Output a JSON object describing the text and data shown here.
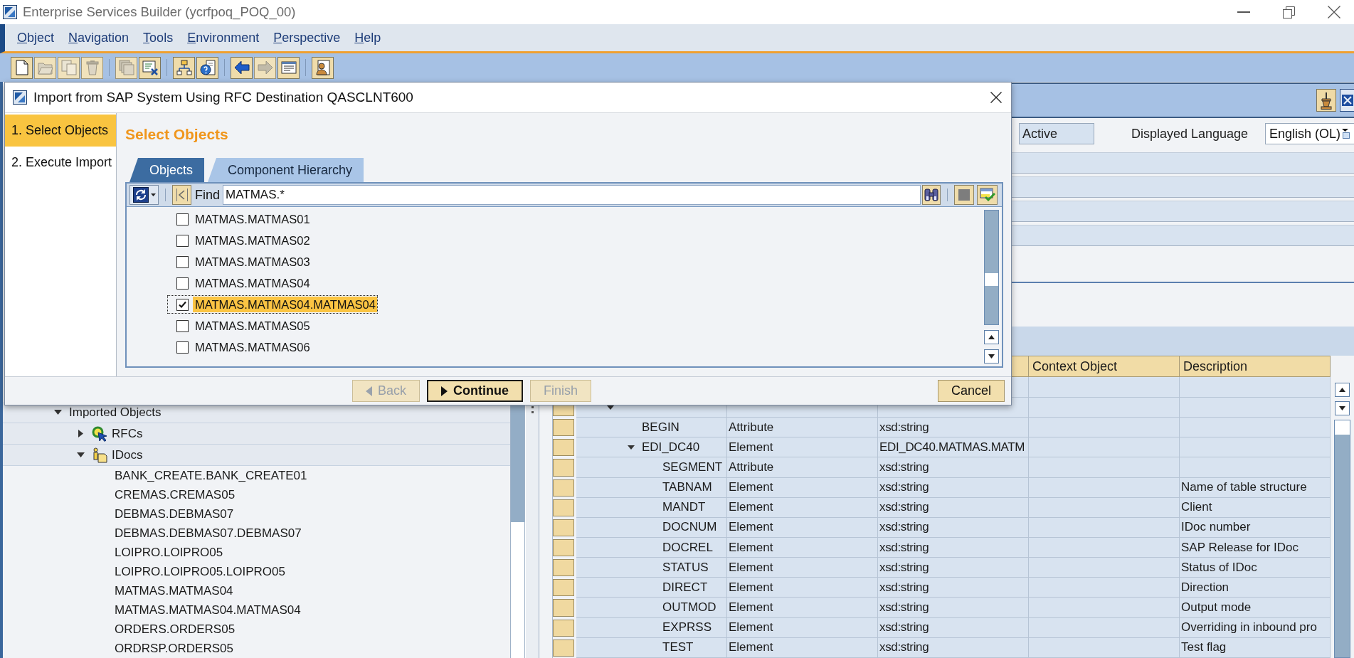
{
  "window": {
    "title": "Enterprise Services Builder (ycrfpoq_POQ_00)"
  },
  "menu": [
    "Object",
    "Navigation",
    "Tools",
    "Environment",
    "Perspective",
    "Help"
  ],
  "toolbar": [
    {
      "buttons": [
        {
          "kind": "new",
          "disabled": false
        },
        {
          "kind": "open",
          "disabled": true
        },
        {
          "kind": "copy",
          "disabled": true
        },
        {
          "kind": "delete",
          "disabled": true
        }
      ]
    },
    {
      "buttons": [
        {
          "kind": "stack",
          "disabled": true
        },
        {
          "kind": "form",
          "disabled": false
        }
      ]
    },
    {
      "buttons": [
        {
          "kind": "network",
          "disabled": false
        },
        {
          "kind": "where-used",
          "disabled": false
        }
      ]
    },
    {
      "buttons": [
        {
          "kind": "back",
          "disabled": false
        },
        {
          "kind": "forward",
          "disabled": true
        },
        {
          "kind": "list",
          "disabled": false
        }
      ]
    },
    {
      "buttons": [
        {
          "kind": "figure",
          "disabled": false
        }
      ]
    }
  ],
  "dialog": {
    "title": "Import from SAP System Using RFC Destination QASCLNT600",
    "steps": [
      {
        "label": "1. Select Objects",
        "selected": true
      },
      {
        "label": "2. Execute Import",
        "selected": false
      }
    ],
    "heading": "Select Objects",
    "tabs": [
      {
        "label": "Objects",
        "selected": true
      },
      {
        "label": "Component Hierarchy",
        "selected": false
      }
    ],
    "find": {
      "label": "Find",
      "value": "MATMAS.*"
    },
    "items": [
      {
        "label": "MATMAS.MATMAS01",
        "checked": false,
        "selected": false
      },
      {
        "label": "MATMAS.MATMAS02",
        "checked": false,
        "selected": false
      },
      {
        "label": "MATMAS.MATMAS03",
        "checked": false,
        "selected": false
      },
      {
        "label": "MATMAS.MATMAS04",
        "checked": false,
        "selected": false
      },
      {
        "label": "MATMAS.MATMAS04.MATMAS04",
        "checked": true,
        "selected": true
      },
      {
        "label": "MATMAS.MATMAS05",
        "checked": false,
        "selected": false
      },
      {
        "label": "MATMAS.MATMAS06",
        "checked": false,
        "selected": false
      }
    ],
    "buttons": [
      {
        "label": "Back",
        "kind": "back",
        "disabled": true,
        "default": false
      },
      {
        "label": "Continue",
        "kind": "continue",
        "disabled": false,
        "default": true
      },
      {
        "label": "Finish",
        "kind": "finish",
        "disabled": true,
        "default": false
      }
    ],
    "cancel_button": {
      "label": "Cancel"
    }
  },
  "editor": {
    "status": "Active",
    "language": {
      "label": "Displayed Language",
      "value": "English (OL)"
    }
  },
  "tree": [
    {
      "label": "Imported Objects",
      "expanded": true,
      "children": [
        {
          "label": "RFCs",
          "kind": "rfc",
          "expanded": false
        },
        {
          "label": "IDocs",
          "kind": "idoc",
          "expanded": true,
          "children": [
            {
              "label": "BANK_CREATE.BANK_CREATE01"
            },
            {
              "label": "CREMAS.CREMAS05"
            },
            {
              "label": "DEBMAS.DEBMAS07"
            },
            {
              "label": "DEBMAS.DEBMAS07.DEBMAS07"
            },
            {
              "label": "LOIPRO.LOIPRO05"
            },
            {
              "label": "LOIPRO.LOIPRO05.LOIPRO05"
            },
            {
              "label": "MATMAS.MATMAS04"
            },
            {
              "label": "MATMAS.MATMAS04.MATMAS04"
            },
            {
              "label": "ORDERS.ORDERS05"
            },
            {
              "label": "ORDRSP.ORDERS05"
            }
          ]
        }
      ]
    }
  ],
  "table": {
    "columns": [
      "Context Object",
      "Description"
    ],
    "rows": [
      {
        "expanded": true,
        "children": [
          {
            "column_1": "BEGIN",
            "column_2": "Attribute",
            "column_3": "xsd:string"
          },
          {
            "column_1": "EDI_DC40",
            "column_2": "Element",
            "column_3": "EDI_DC40.MATMAS.MATM",
            "expanded": true,
            "children": [
              {
                "column_1": "SEGMENT",
                "column_2": "Attribute",
                "column_3": "xsd:string"
              },
              {
                "column_1": "TABNAM",
                "column_2": "Element",
                "column_3": "xsd:string",
                "description": "Name of table structure"
              },
              {
                "column_1": "MANDT",
                "column_2": "Element",
                "column_3": "xsd:string",
                "description": "Client"
              },
              {
                "column_1": "DOCNUM",
                "column_2": "Element",
                "column_3": "xsd:string",
                "description": "IDoc number"
              },
              {
                "column_1": "DOCREL",
                "column_2": "Element",
                "column_3": "xsd:string",
                "description": "SAP Release for IDoc"
              },
              {
                "column_1": "STATUS",
                "column_2": "Element",
                "column_3": "xsd:string",
                "description": "Status of IDoc"
              },
              {
                "column_1": "DIRECT",
                "column_2": "Element",
                "column_3": "xsd:string",
                "description": "Direction"
              },
              {
                "column_1": "OUTMOD",
                "column_2": "Element",
                "column_3": "xsd:string",
                "description": "Output mode"
              },
              {
                "column_1": "EXPRSS",
                "column_2": "Element",
                "column_3": "xsd:string",
                "description": "Overriding in inbound pro"
              },
              {
                "column_1": "TEST",
                "column_2": "Element",
                "column_3": "xsd:string",
                "description": "Test flag"
              }
            ]
          }
        ]
      }
    ]
  }
}
